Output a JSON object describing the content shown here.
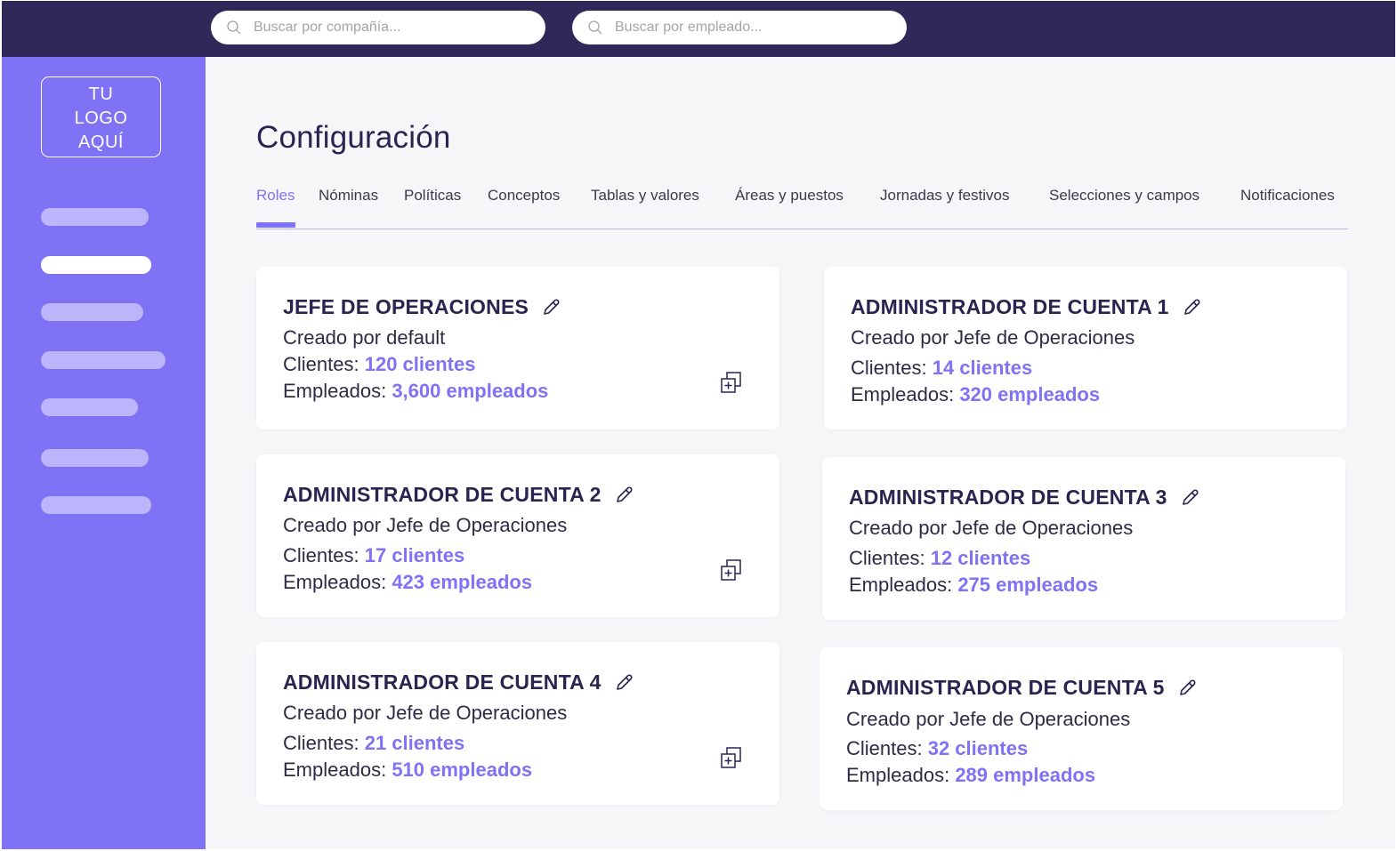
{
  "search": {
    "company_placeholder": "Buscar por compañía...",
    "employee_placeholder": "Buscar por empleado..."
  },
  "sidebar": {
    "logo_lines": [
      "TU",
      "LOGO",
      "AQUÍ"
    ],
    "active_index": 1
  },
  "page": {
    "title": "Configuración"
  },
  "tabs": [
    {
      "label": "Roles",
      "active": true
    },
    {
      "label": "Nóminas"
    },
    {
      "label": "Políticas"
    },
    {
      "label": "Conceptos"
    },
    {
      "label": "Tablas y valores"
    },
    {
      "label": "Áreas y puestos"
    },
    {
      "label": "Jornadas y festivos"
    },
    {
      "label": "Selecciones y campos"
    },
    {
      "label": "Notificaciones"
    }
  ],
  "labels": {
    "clients": "Clientes:",
    "employees": "Empleados:"
  },
  "roles": [
    {
      "title": "JEFE DE OPERACIONES",
      "created_by": "Creado por default",
      "clients": "120 clientes",
      "employees": "3,600 empleados",
      "duplicable": true
    },
    {
      "title": "ADMINISTRADOR DE CUENTA 1",
      "created_by": "Creado por Jefe de Operaciones",
      "clients": "14 clientes",
      "employees": "320 empleados",
      "duplicable": false
    },
    {
      "title": "ADMINISTRADOR DE CUENTA 2",
      "created_by": "Creado por Jefe de Operaciones",
      "clients": "17 clientes",
      "employees": "423 empleados",
      "duplicable": true
    },
    {
      "title": "ADMINISTRADOR DE CUENTA 3",
      "created_by": "Creado por Jefe de Operaciones",
      "clients": "12 clientes",
      "employees": "275 empleados",
      "duplicable": false
    },
    {
      "title": "ADMINISTRADOR DE CUENTA 4",
      "created_by": "Creado por Jefe de Operaciones",
      "clients": "21 clientes",
      "employees": "510 empleados",
      "duplicable": true
    },
    {
      "title": "ADMINISTRADOR DE CUENTA 5",
      "created_by": "Creado por Jefe de Operaciones",
      "clients": "32 clientes",
      "employees": "289 empleados",
      "duplicable": false
    }
  ],
  "colors": {
    "topbar": "#31285a",
    "sidebar": "#7f72f5",
    "accent": "#7f72f5",
    "nav_placeholder": "#bcb5fb",
    "heading": "#2a2450"
  },
  "icons": {
    "search": "search-icon",
    "edit": "pencil-icon",
    "duplicate": "duplicate-icon"
  }
}
